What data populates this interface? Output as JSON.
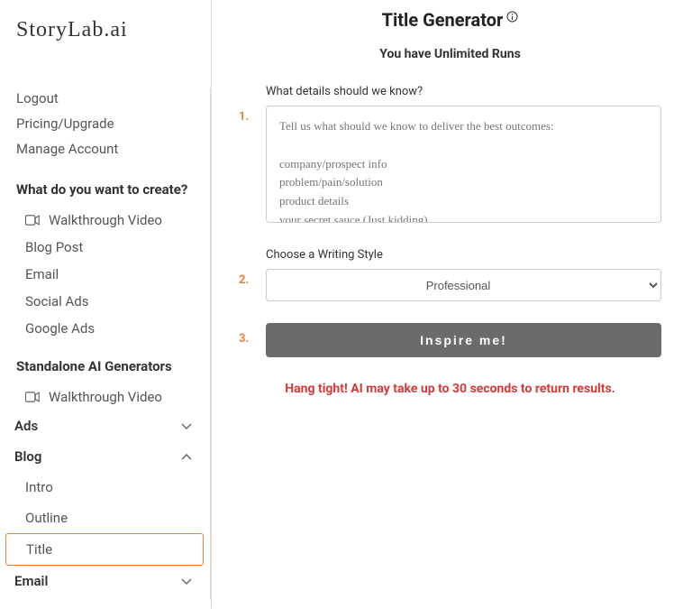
{
  "logo": "StoryLab.ai",
  "sidebar": {
    "navLinks": [
      "Logout",
      "Pricing/Upgrade",
      "Manage Account"
    ],
    "createTitle": "What do you want to create?",
    "walkthrough": "Walkthrough Video",
    "createItems": [
      "Blog Post",
      "Email",
      "Social Ads",
      "Google Ads"
    ],
    "generatorsTitle": "Standalone AI Generators",
    "accordions": {
      "ads": "Ads",
      "blog": "Blog",
      "email": "Email"
    },
    "blogSubs": [
      "Intro",
      "Outline",
      "Title"
    ]
  },
  "main": {
    "title": "Title Generator",
    "runsText": "You have Unlimited Runs",
    "step1": {
      "num": "1.",
      "label": "What details should we know?",
      "placeholder": "Tell us what should we know to deliver the best outcomes:\n\ncompany/prospect info\nproblem/pain/solution\nproduct details\nyour secret sauce (Just kidding)"
    },
    "step2": {
      "num": "2.",
      "label": "Choose a Writing Style",
      "selected": "Professional"
    },
    "step3": {
      "num": "3.",
      "button": "Inspire me!"
    },
    "waitText": "Hang tight! AI may take up to 30 seconds to return results."
  }
}
